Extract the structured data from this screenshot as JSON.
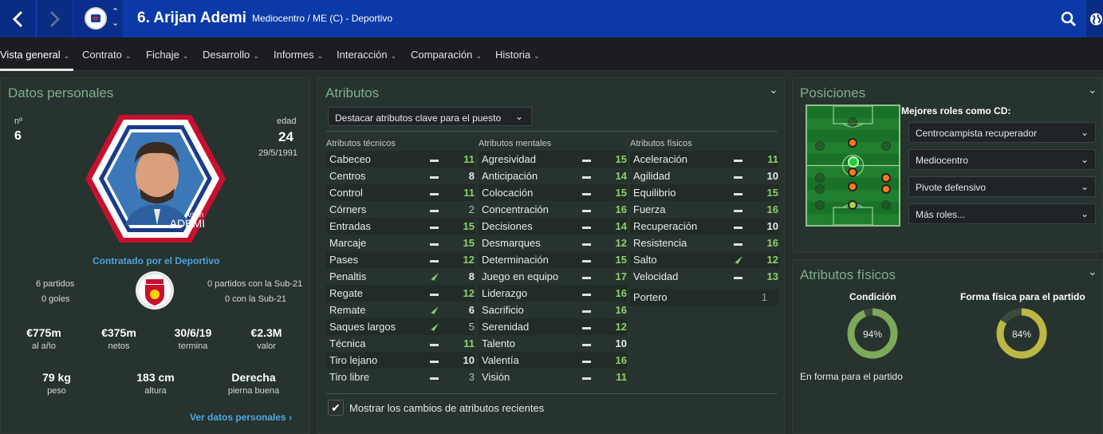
{
  "topbar": {
    "player_title": "6. Arijan Ademi",
    "player_sub": "Mediocentro / ME (C) - Deportivo"
  },
  "nav": [
    {
      "label": "Vista general"
    },
    {
      "label": "Contrato"
    },
    {
      "label": "Fichaje"
    },
    {
      "label": "Desarrollo"
    },
    {
      "label": "Informes"
    },
    {
      "label": "Interacción"
    },
    {
      "label": "Comparación"
    },
    {
      "label": "Historia"
    }
  ],
  "personal": {
    "title": "Datos personales",
    "num_label": "nº",
    "num": "6",
    "age_label": "edad",
    "age": "24",
    "dob": "29/5/1991",
    "photo_name_small": "Arijan",
    "photo_name_big": "ADEMI",
    "contract_by": "Contratado por el Deportivo",
    "caps": "6 partidos",
    "goals": "0 goles",
    "u21_caps": "0 partidos con la Sub-21",
    "u21_goals": "0 con la Sub-21",
    "stats": [
      {
        "value": "€775m",
        "label": "al año"
      },
      {
        "value": "€375m",
        "label": "netos"
      },
      {
        "value": "30/6/19",
        "label": "termina"
      },
      {
        "value": "€2.3M",
        "label": "valor"
      }
    ],
    "stats2": [
      {
        "value": "79 kg",
        "label": "peso"
      },
      {
        "value": "183 cm",
        "label": "altura"
      },
      {
        "value": "Derecha",
        "label": "pierna buena"
      }
    ],
    "link": "Ver datos personales"
  },
  "attributes": {
    "title": "Atributos",
    "highlight_label": "Destacar atributos clave para el puesto",
    "col_tech": "Atributos técnicos",
    "col_mental": "Atributos mentales",
    "col_phys": "Atributos físicos",
    "technical": [
      {
        "name": "Cabeceo",
        "trend": "=",
        "value": "11"
      },
      {
        "name": "Centros",
        "trend": "=",
        "value": "8"
      },
      {
        "name": "Control",
        "trend": "=",
        "value": "11"
      },
      {
        "name": "Córners",
        "trend": "=",
        "value": "2"
      },
      {
        "name": "Entradas",
        "trend": "=",
        "value": "15"
      },
      {
        "name": "Marcaje",
        "trend": "=",
        "value": "15"
      },
      {
        "name": "Pases",
        "trend": "=",
        "value": "12"
      },
      {
        "name": "Penaltis",
        "trend": "up",
        "value": "8"
      },
      {
        "name": "Regate",
        "trend": "=",
        "value": "12"
      },
      {
        "name": "Remate",
        "trend": "up",
        "value": "6"
      },
      {
        "name": "Saques largos",
        "trend": "up",
        "value": "5"
      },
      {
        "name": "Técnica",
        "trend": "=",
        "value": "11"
      },
      {
        "name": "Tiro lejano",
        "trend": "=",
        "value": "10"
      },
      {
        "name": "Tiro libre",
        "trend": "=",
        "value": "3"
      }
    ],
    "mental": [
      {
        "name": "Agresividad",
        "trend": "=",
        "value": "15"
      },
      {
        "name": "Anticipación",
        "trend": "=",
        "value": "14"
      },
      {
        "name": "Colocación",
        "trend": "=",
        "value": "15"
      },
      {
        "name": "Concentración",
        "trend": "=",
        "value": "16"
      },
      {
        "name": "Decisiones",
        "trend": "=",
        "value": "14"
      },
      {
        "name": "Desmarques",
        "trend": "=",
        "value": "12"
      },
      {
        "name": "Determinación",
        "trend": "=",
        "value": "15"
      },
      {
        "name": "Juego en equipo",
        "trend": "=",
        "value": "17"
      },
      {
        "name": "Liderazgo",
        "trend": "=",
        "value": "16"
      },
      {
        "name": "Sacrificio",
        "trend": "=",
        "value": "16"
      },
      {
        "name": "Serenidad",
        "trend": "=",
        "value": "12"
      },
      {
        "name": "Talento",
        "trend": "=",
        "value": "10"
      },
      {
        "name": "Valentía",
        "trend": "=",
        "value": "16"
      },
      {
        "name": "Visión",
        "trend": "=",
        "value": "11"
      }
    ],
    "physical": [
      {
        "name": "Aceleración",
        "trend": "=",
        "value": "11"
      },
      {
        "name": "Agilidad",
        "trend": "=",
        "value": "10"
      },
      {
        "name": "Equilibrio",
        "trend": "=",
        "value": "15"
      },
      {
        "name": "Fuerza",
        "trend": "=",
        "value": "16"
      },
      {
        "name": "Recuperación",
        "trend": "=",
        "value": "10"
      },
      {
        "name": "Resistencia",
        "trend": "=",
        "value": "16"
      },
      {
        "name": "Salto",
        "trend": "up",
        "value": "12"
      },
      {
        "name": "Velocidad",
        "trend": "=",
        "value": "13"
      }
    ],
    "goalkeeper_label": "Portero",
    "goalkeeper_value": "1",
    "show_changes": "Mostrar los cambios de atributos recientes"
  },
  "positions": {
    "title": "Posiciones",
    "best_roles_label": "Mejores roles como CD:",
    "roles": [
      "Centrocampista recuperador",
      "Mediocentro",
      "Pivote defensivo",
      "Más roles..."
    ],
    "pitch_dots": [
      {
        "color": "#ff7a1a"
      },
      {
        "color": "#22cc33"
      },
      {
        "color": "#ff7a1a"
      },
      {
        "color": "#ff7a1a"
      },
      {
        "color": "#ff7a1a"
      },
      {
        "color": "#ff7a1a"
      },
      {
        "color": "#a8d04a"
      }
    ]
  },
  "physical_panel": {
    "title": "Atributos físicos",
    "condition_label": "Condición",
    "condition_value": "94%",
    "condition_level": 0.94,
    "match_fitness_label": "Forma física para el partido",
    "match_fitness_value": "84%",
    "match_fitness_level": 0.84,
    "status": "En forma para el partido"
  }
}
